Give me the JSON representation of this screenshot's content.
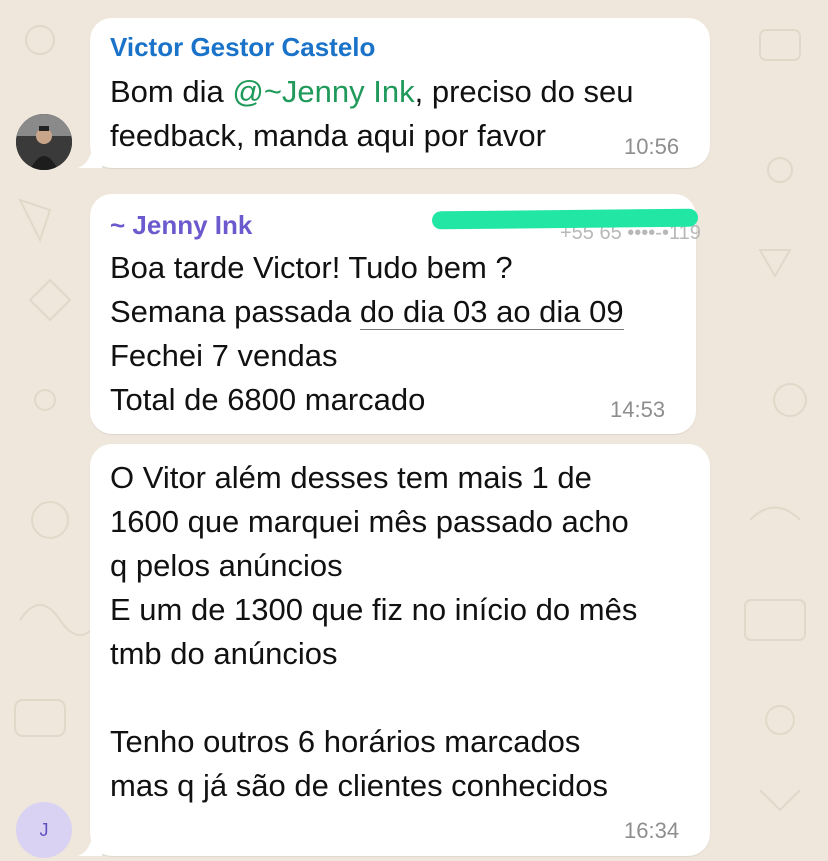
{
  "colors": {
    "background": "#efe7dc",
    "bubble": "#ffffff",
    "sender_victor": "#1a73c9",
    "sender_jenny": "#6a5acd",
    "mention": "#1f9a5a",
    "timestamp": "#8e8e8e",
    "redaction": "#22e6a4"
  },
  "messages": [
    {
      "sender": "Victor Gestor Castelo",
      "avatar_icon": "user-photo-avatar",
      "text_prefix": "Bom dia ",
      "mention": "@~Jenny Ink",
      "text_suffix": ", preciso do seu\nfeedback, manda aqui por favor",
      "time": "10:56"
    },
    {
      "sender": "~ Jenny Ink",
      "redacted_phone": "+55 65 ••••-•119",
      "line1": "Boa tarde Victor! Tudo bem ?",
      "line2_prefix": "Semana passada ",
      "line2_link": "do dia 03 ao dia 09",
      "line3": "Fechei 7 vendas",
      "line4": "Total de 6800 marcado",
      "time": "14:53"
    },
    {
      "avatar_letter": "J",
      "text": "O Vitor além desses tem mais 1 de\n1600 que marquei mês passado acho\nq pelos anúncios\nE um de 1300 que fiz no início do mês\ntmb do anúncios\n\nTenho outros 6 horários marcados\nmas q já são de clientes conhecidos",
      "time": "16:34"
    }
  ]
}
